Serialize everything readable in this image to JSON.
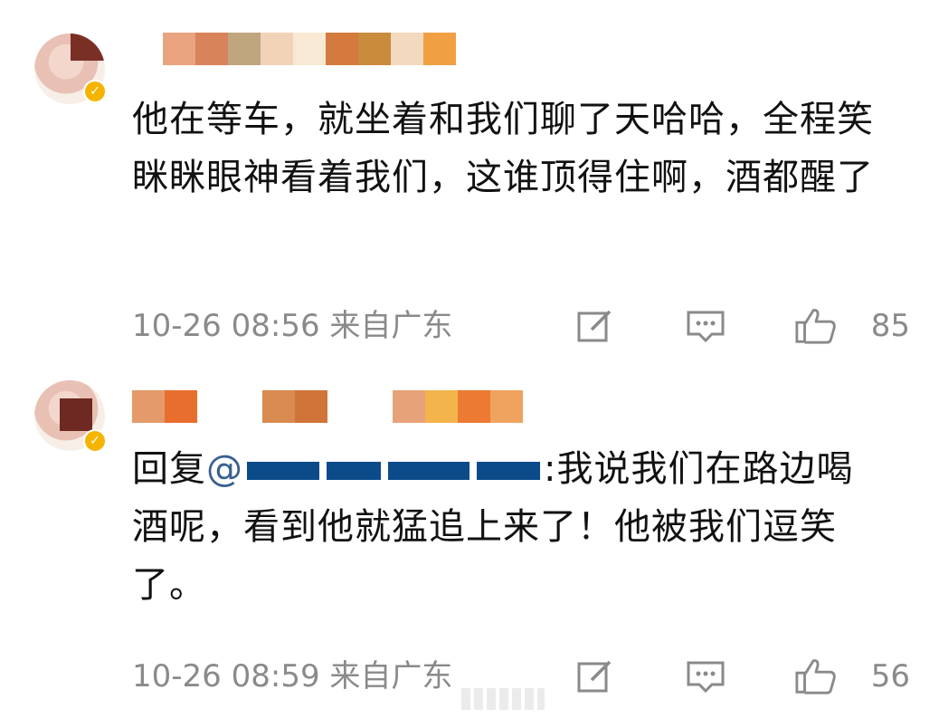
{
  "comments": [
    {
      "text": "他在等车，就坐着和我们聊了天哈哈，全程笑眯眯眼神看着我们，这谁顶得住啊，酒都醒了",
      "time_location": "10-26 08:56 来自广东",
      "likes": "85",
      "name_colors": [
        "#e9a47f",
        "#d9835b",
        "#c0a67e",
        "#f2d3b8",
        "#f7e9d4",
        "#d47a3f",
        "#c98b3c",
        "#f3d9bd",
        "#f0a043"
      ]
    },
    {
      "reply_prefix": "回复",
      "mention": "@",
      "text": ":我说我们在路边喝酒呢，看到他就猛追上来了！他被我们逗笑了。",
      "time_location": "10-26 08:59 来自广东",
      "likes": "56",
      "name_colors": [
        "#e49a6b",
        "#e86e2e",
        "#d88a4f",
        "#d0743a",
        "#e8a27a",
        "#f3b44b",
        "#ec7a33",
        "#f0a35f"
      ]
    }
  ],
  "icons": [
    "edit-icon",
    "comment-icon",
    "thumbs-up-icon",
    "verified-badge-icon"
  ],
  "colors": {
    "text": "#111111",
    "meta": "#8a8a8a",
    "mention": "#3a5f8f",
    "badge": "#f5b400"
  }
}
